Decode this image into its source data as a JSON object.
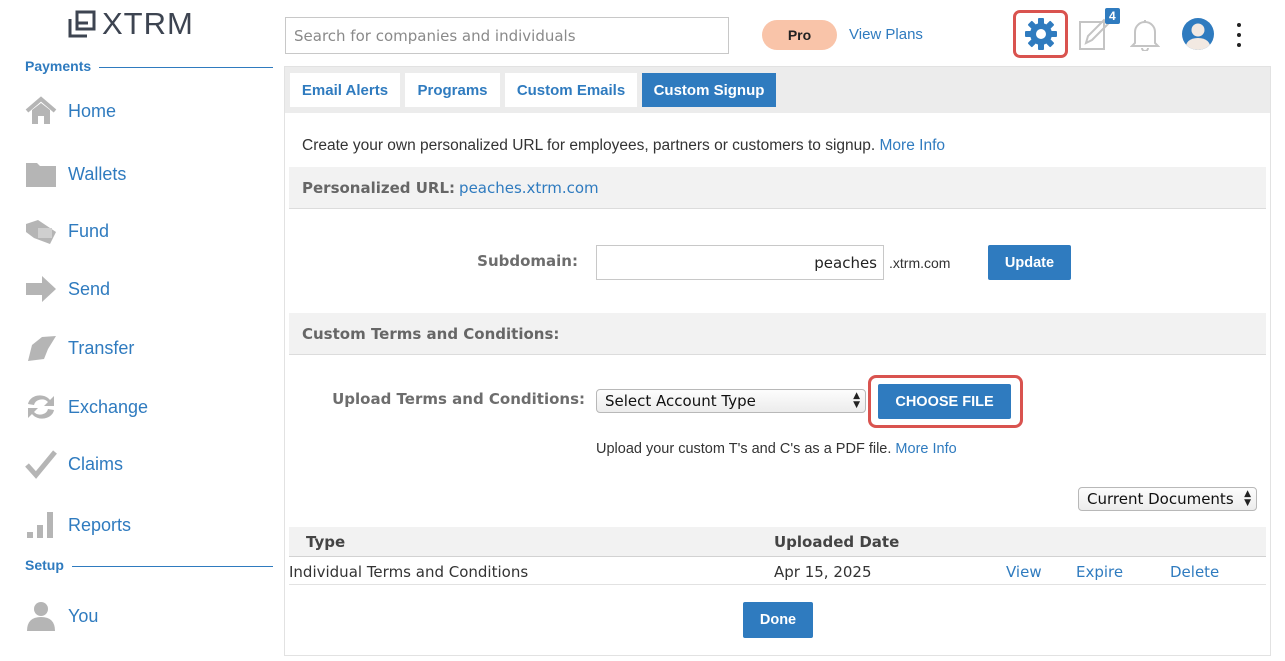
{
  "brand": {
    "name": "XTRM"
  },
  "sidebar": {
    "sections": [
      {
        "title": "Payments"
      },
      {
        "title": "Setup"
      }
    ],
    "items": [
      {
        "label": "Home",
        "icon": "home-icon"
      },
      {
        "label": "Wallets",
        "icon": "folder-icon"
      },
      {
        "label": "Fund",
        "icon": "fund-icon"
      },
      {
        "label": "Send",
        "icon": "arrow-right-icon"
      },
      {
        "label": "Transfer",
        "icon": "transfer-icon"
      },
      {
        "label": "Exchange",
        "icon": "exchange-icon"
      },
      {
        "label": "Claims",
        "icon": "checkmark-icon"
      },
      {
        "label": "Reports",
        "icon": "bar-chart-icon"
      },
      {
        "label": "You",
        "icon": "user-icon"
      }
    ]
  },
  "topbar": {
    "search_placeholder": "Search for companies and individuals",
    "plan_badge": "Pro",
    "view_plans": "View Plans",
    "notifications_count": "4",
    "colors": {
      "accent": "#2f7bbf",
      "highlight": "#d9534f",
      "badge": "#f9c4a9"
    }
  },
  "tabs": [
    {
      "label": "Email Alerts",
      "active": false
    },
    {
      "label": "Programs",
      "active": false
    },
    {
      "label": "Custom Emails",
      "active": false
    },
    {
      "label": "Custom Signup",
      "active": true
    }
  ],
  "content": {
    "intro": "Create your own personalized URL for employees, partners or customers to signup.",
    "more_info": "More Info",
    "personalized_url_label": "Personalized URL:",
    "personalized_url_value": "peaches.xtrm.com",
    "subdomain_label": "Subdomain:",
    "subdomain_value": "peaches",
    "domain_suffix": ".xtrm.com",
    "update_button": "Update",
    "terms_section_title": "Custom Terms and Conditions:",
    "upload_label": "Upload Terms and Conditions:",
    "account_type_select": "Select Account Type",
    "choose_file_button": "CHOOSE FILE",
    "upload_helper": "Upload your custom T's and C's as a PDF file.",
    "documents_filter": "Current Documents",
    "table": {
      "columns": [
        "Type",
        "Uploaded Date"
      ],
      "rows": [
        {
          "type": "Individual Terms and Conditions",
          "date": "Apr 15, 2025",
          "actions": [
            "View",
            "Expire",
            "Delete"
          ]
        }
      ]
    },
    "done_button": "Done"
  }
}
